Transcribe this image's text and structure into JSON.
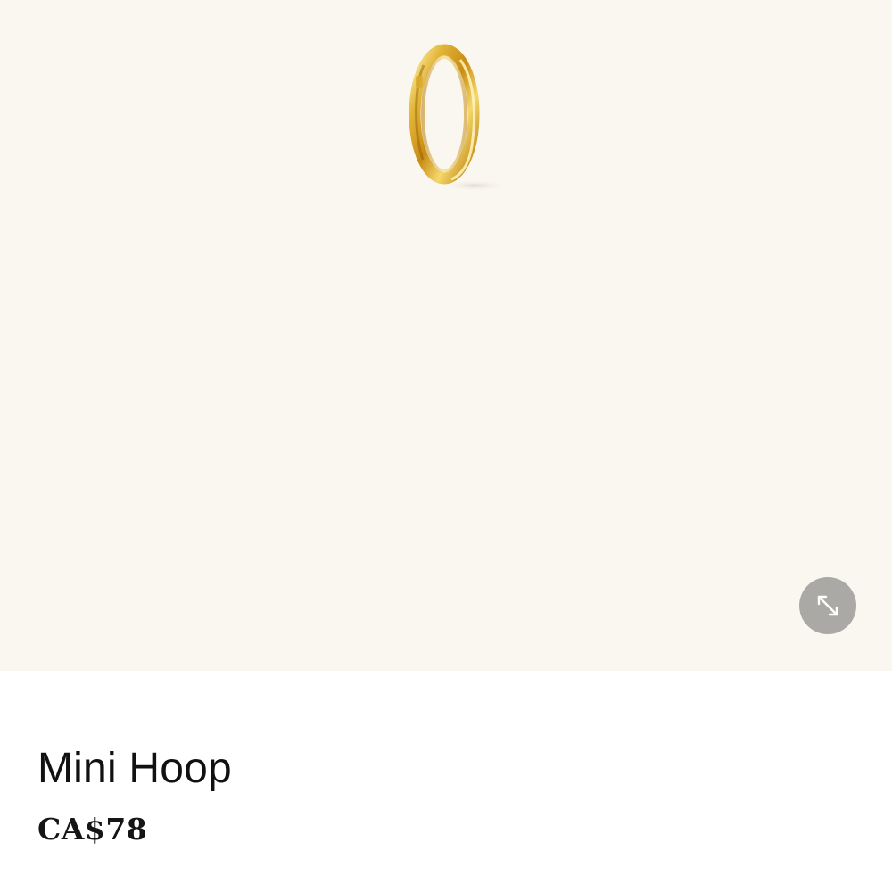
{
  "product": {
    "title": "Mini Hoop",
    "price": "CA$78"
  },
  "gallery": {
    "background_color": "#faf7f0",
    "image_icon": "gold-hoop-earring",
    "expand_icon": "expand-arrows-icon"
  }
}
